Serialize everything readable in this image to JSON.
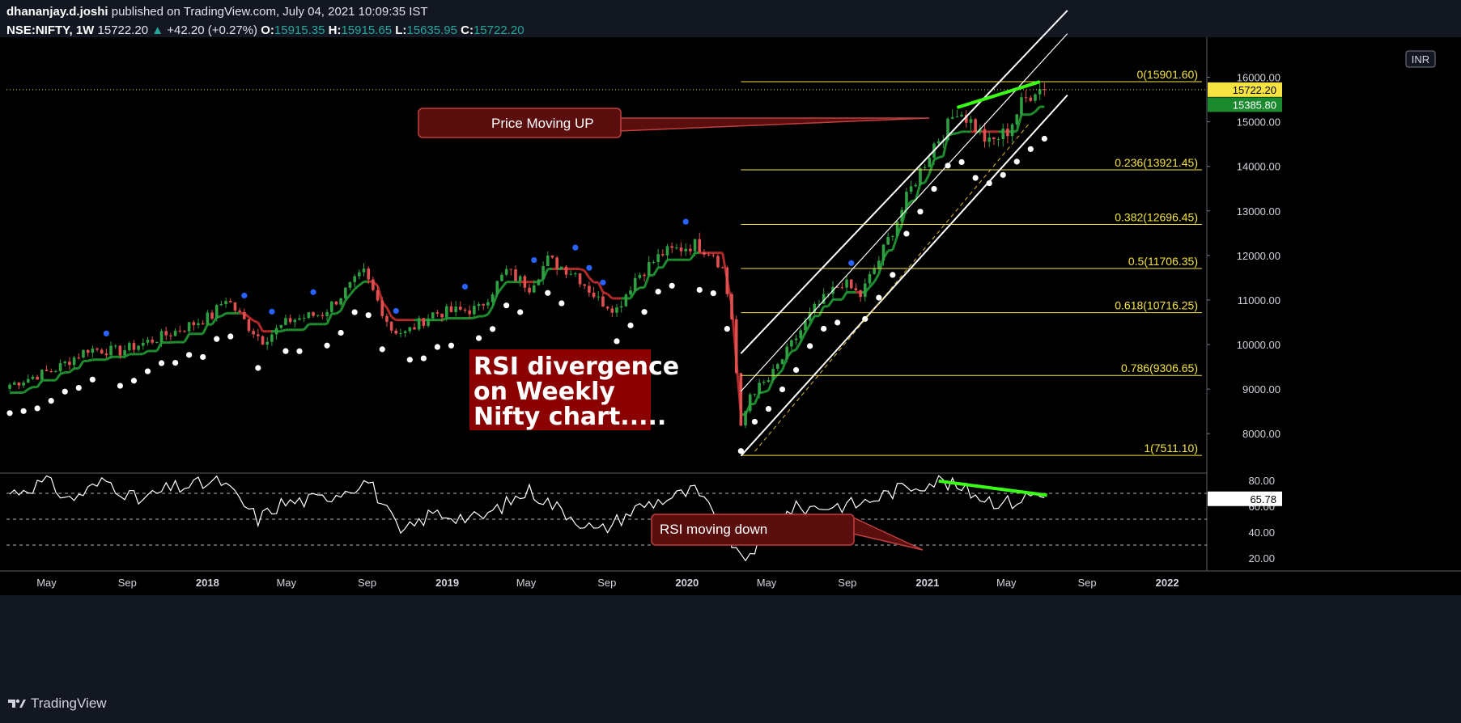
{
  "header": {
    "author": "dhananjay.d.joshi",
    "published_text": "published on TradingView.com, July 04, 2021 10:09:35 IST",
    "symbol": "NSE:NIFTY, 1W",
    "last": "15722.20",
    "change": "+42.20 (+0.27%)",
    "open_label": "O:",
    "open": "15915.35",
    "high_label": "H:",
    "high": "15915.65",
    "low_label": "L:",
    "low": "15635.95",
    "close_label": "C:",
    "close": "15722.20"
  },
  "footer": {
    "brand": "TradingView"
  },
  "colors": {
    "bg": "#000000",
    "up": "#2ea043",
    "down": "#e05050",
    "fib": "#f5e342",
    "psar_top": "#2962ff",
    "psar_bottom": "#ffffff",
    "trend_green": "#1e8c2e",
    "trend_red": "#b02a2a",
    "rsi": "#ffffff",
    "highlight": "#39ff14",
    "annot": "#5a0e0e"
  },
  "currency_badge": "INR",
  "annotations": {
    "price": "Price Moving UP",
    "rsi": "RSI moving down",
    "main_lines": [
      "RSI divergence",
      "on Weekly",
      "Nifty chart....."
    ]
  },
  "chart_data": [
    {
      "type": "line",
      "title": "",
      "y_axis_ticks": [
        "8000.00",
        "9000.00",
        "10000.00",
        "11000.00",
        "12000.00",
        "13000.00",
        "14000.00",
        "15000.00",
        "16000.00"
      ],
      "ylim": [
        7150,
        16900
      ],
      "x_axis_ticks": [
        "May",
        "Sep",
        "2018",
        "May",
        "Sep",
        "2019",
        "May",
        "Sep",
        "2020",
        "May",
        "Sep",
        "2021",
        "May",
        "Sep",
        "2022"
      ],
      "price_labels": {
        "last": "15722.20",
        "trend": "15385.80"
      },
      "fib_levels": [
        {
          "label": "0(15901.60)",
          "value": 15901.6
        },
        {
          "label": "0.236(13921.45)",
          "value": 13921.45
        },
        {
          "label": "0.382(12696.45)",
          "value": 12696.45
        },
        {
          "label": "0.5(11706.35)",
          "value": 11706.35
        },
        {
          "label": "0.618(10716.25)",
          "value": 10716.25
        },
        {
          "label": "0.786(9306.65)",
          "value": 9306.65
        },
        {
          "label": "1(7511.10)",
          "value": 7511.1
        }
      ],
      "weekly_close_anchors": [
        [
          "2017-03-06",
          9100
        ],
        [
          "2017-05-15",
          9450
        ],
        [
          "2017-07-03",
          9900
        ],
        [
          "2017-08-21",
          9850
        ],
        [
          "2017-10-09",
          10100
        ],
        [
          "2017-11-13",
          10300
        ],
        [
          "2018-01-08",
          10650
        ],
        [
          "2018-01-29",
          11050
        ],
        [
          "2018-03-05",
          10400
        ],
        [
          "2018-03-26",
          10100
        ],
        [
          "2018-05-07",
          10550
        ],
        [
          "2018-06-25",
          10700
        ],
        [
          "2018-08-27",
          11600
        ],
        [
          "2018-10-08",
          10350
        ],
        [
          "2018-10-29",
          10250
        ],
        [
          "2018-12-10",
          10700
        ],
        [
          "2019-02-18",
          10800
        ],
        [
          "2019-04-01",
          11650
        ],
        [
          "2019-05-06",
          11300
        ],
        [
          "2019-06-03",
          11900
        ],
        [
          "2019-07-15",
          11600
        ],
        [
          "2019-08-19",
          11000
        ],
        [
          "2019-09-16",
          10800
        ],
        [
          "2019-10-14",
          11500
        ],
        [
          "2019-11-25",
          12050
        ],
        [
          "2020-01-13",
          12250
        ],
        [
          "2020-02-10",
          12050
        ],
        [
          "2020-02-24",
          11700
        ],
        [
          "2020-03-09",
          10600
        ],
        [
          "2020-03-23",
          8100
        ],
        [
          "2020-04-06",
          8900
        ],
        [
          "2020-05-04",
          9200
        ],
        [
          "2020-06-08",
          10000
        ],
        [
          "2020-07-13",
          10800
        ],
        [
          "2020-08-24",
          11400
        ],
        [
          "2020-09-21",
          11100
        ],
        [
          "2020-10-19",
          11900
        ],
        [
          "2020-11-16",
          12800
        ],
        [
          "2020-12-07",
          13500
        ],
        [
          "2021-01-11",
          14500
        ],
        [
          "2021-02-01",
          14900
        ],
        [
          "2021-02-15",
          15300
        ],
        [
          "2021-03-08",
          15000
        ],
        [
          "2021-04-05",
          14500
        ],
        [
          "2021-05-03",
          14800
        ],
        [
          "2021-05-24",
          15400
        ],
        [
          "2021-06-14",
          15750
        ],
        [
          "2021-07-02",
          15722
        ]
      ],
      "channel": {
        "upper": [
          [
            "2020-03-23",
            9800
          ],
          [
            "2021-08-02",
            17500
          ]
        ],
        "lower": [
          [
            "2020-03-23",
            7500
          ],
          [
            "2021-08-02",
            15600
          ]
        ],
        "inner": [
          [
            "2020-03-23",
            8950
          ],
          [
            "2021-08-02",
            16980
          ]
        ],
        "dashed": [
          [
            "2020-04-13",
            7600
          ],
          [
            "2021-06-07",
            15000
          ]
        ]
      },
      "divergence_price": [
        [
          "2021-02-15",
          15320
        ],
        [
          "2021-06-21",
          15900
        ]
      ]
    },
    {
      "type": "line",
      "title": "",
      "y_axis_ticks": [
        "20.00",
        "40.00",
        "60.00",
        "80.00"
      ],
      "ylim": [
        10,
        85
      ],
      "bands": [
        30,
        50,
        70
      ],
      "last_value": "65.78",
      "rsi_anchors": [
        [
          "2017-03-06",
          70
        ],
        [
          "2017-05-01",
          79
        ],
        [
          "2017-06-05",
          65
        ],
        [
          "2017-07-31",
          80
        ],
        [
          "2017-09-18",
          64
        ],
        [
          "2017-11-06",
          74
        ],
        [
          "2018-01-22",
          79
        ],
        [
          "2018-03-19",
          50
        ],
        [
          "2018-04-23",
          62
        ],
        [
          "2018-06-25",
          66
        ],
        [
          "2018-09-03",
          80
        ],
        [
          "2018-10-22",
          38
        ],
        [
          "2018-12-10",
          55
        ],
        [
          "2019-02-18",
          50
        ],
        [
          "2019-05-06",
          72
        ],
        [
          "2019-08-19",
          40
        ],
        [
          "2019-10-21",
          60
        ],
        [
          "2020-01-13",
          72
        ],
        [
          "2020-03-02",
          40
        ],
        [
          "2020-03-23",
          17
        ],
        [
          "2020-06-08",
          58
        ],
        [
          "2020-09-21",
          62
        ],
        [
          "2020-11-23",
          74
        ],
        [
          "2021-01-18",
          80
        ],
        [
          "2021-04-12",
          64
        ],
        [
          "2021-05-10",
          63
        ],
        [
          "2021-06-14",
          70
        ],
        [
          "2021-07-02",
          65.78
        ]
      ],
      "divergence_rsi": [
        [
          "2021-01-18",
          79.5
        ],
        [
          "2021-07-02",
          68.5
        ]
      ]
    }
  ]
}
